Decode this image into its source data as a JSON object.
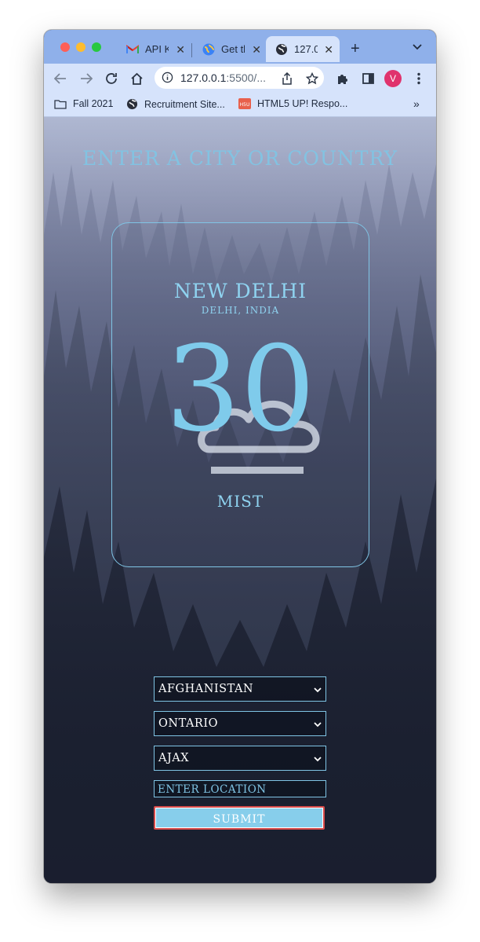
{
  "browser": {
    "tabs": [
      {
        "label": "API K",
        "icon": "gmail-icon"
      },
      {
        "label": "Get th",
        "icon": "globe-icon"
      },
      {
        "label": "127.0",
        "icon": "web-icon",
        "active": true
      }
    ],
    "url_host": "127.0.0.1",
    "url_rest": ":5500/...",
    "avatar_initial": "V",
    "bookmarks": [
      {
        "label": "Fall 2021",
        "icon": "folder-icon"
      },
      {
        "label": "Recruitment Site...",
        "icon": "globe-icon"
      },
      {
        "label": "HTML5 UP! Respo...",
        "icon": "html5up-icon"
      }
    ],
    "bookmarks_more": "»"
  },
  "page": {
    "heading": "ENTER A CITY OR COUNTRY",
    "weather": {
      "city": "NEW DELHI",
      "region": "DELHI, INDIA",
      "temperature": "30",
      "condition": "MIST",
      "icon": "mist-cloud-icon"
    },
    "form": {
      "country": "AFGHANISTAN",
      "state": "ONTARIO",
      "city": "AJAX",
      "location_placeholder": "ENTER LOCATION",
      "submit_label": "SUBMIT"
    }
  },
  "colors": {
    "accent": "#87ceeb",
    "text_accent": "#8fd3f0",
    "tabstrip": "#8fb0ea",
    "toolbar": "#d6e3fb",
    "avatar": "#e0336d"
  }
}
